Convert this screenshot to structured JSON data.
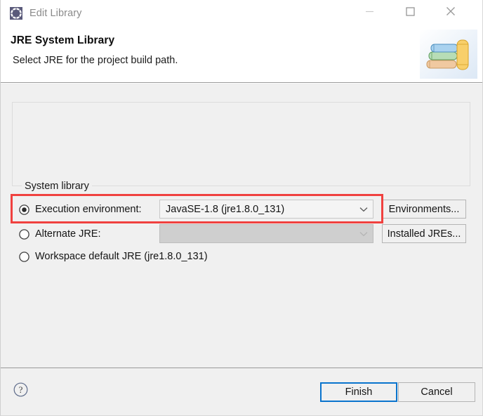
{
  "window": {
    "title": "Edit Library",
    "icon": "eclipse-library-icon",
    "controls": {
      "minimize": "minimize-icon",
      "maximize": "maximize-icon",
      "close": "close-icon"
    }
  },
  "header": {
    "title": "JRE System Library",
    "subtitle": "Select JRE for the project build path.",
    "image": "book-stack-icon"
  },
  "group": {
    "legend": "System library"
  },
  "options": [
    {
      "id": "execution-environment",
      "label": "Execution environment:",
      "selected": true,
      "combo": {
        "value": "JavaSE-1.8 (jre1.8.0_131)",
        "enabled": true,
        "arrow": "chevron-down-icon"
      },
      "side_button": "Environments..."
    },
    {
      "id": "alternate-jre",
      "label": "Alternate JRE:",
      "selected": false,
      "combo": {
        "value": "",
        "enabled": false,
        "arrow": "chevron-down-icon"
      },
      "side_button": "Installed JREs..."
    },
    {
      "id": "workspace-default-jre",
      "label": "Workspace default JRE (jre1.8.0_131)",
      "selected": false
    }
  ],
  "footer": {
    "help": "help-icon",
    "finish_label": "Finish",
    "cancel_label": "Cancel"
  },
  "colors": {
    "highlight": "#f0413f",
    "focus": "#0a74cd",
    "titlebar_bg": "#ffffff",
    "body_bg": "#f0f0f0",
    "disabled_field": "#cfcfcf"
  }
}
